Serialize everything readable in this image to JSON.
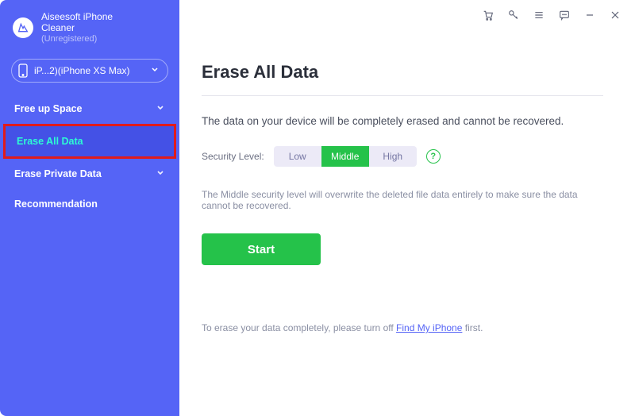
{
  "brand": {
    "title_line1": "Aiseesoft iPhone",
    "title_line2": "Cleaner",
    "sub": "(Unregistered)"
  },
  "device": {
    "label": "iP...2)(iPhone XS Max)"
  },
  "sidebar": {
    "items": [
      {
        "label": "Free up Space"
      },
      {
        "label": "Erase All Data"
      },
      {
        "label": "Erase Private Data"
      },
      {
        "label": "Recommendation"
      }
    ]
  },
  "main": {
    "heading": "Erase All Data",
    "description": "The data on your device will be completely erased and cannot be recovered.",
    "security_label": "Security Level:",
    "levels": {
      "low": "Low",
      "middle": "Middle",
      "high": "High"
    },
    "selected_level": "middle",
    "level_hint": "The Middle security level will overwrite the deleted file data entirely to make sure the data cannot be recovered.",
    "start": "Start",
    "footnote_pre": "To erase your data completely, please turn off ",
    "footnote_link": "Find My iPhone",
    "footnote_post": " first."
  },
  "colors": {
    "sidebar": "#5564f6",
    "accent_green": "#25c24a",
    "highlight_text": "#2dfad4"
  }
}
